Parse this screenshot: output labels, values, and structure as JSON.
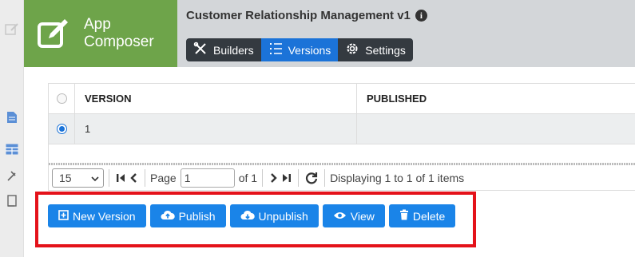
{
  "brand": {
    "line1": "App",
    "line2": "Composer"
  },
  "app": {
    "title": "Customer Relationship Management v1"
  },
  "tabs": [
    {
      "label": "Builders",
      "icon": "tools-icon"
    },
    {
      "label": "Versions",
      "icon": "list-icon"
    },
    {
      "label": "Settings",
      "icon": "gear-icon"
    }
  ],
  "grid": {
    "columns": [
      "VERSION",
      "PUBLISHED"
    ],
    "rows": [
      {
        "version": "1",
        "published": ""
      }
    ]
  },
  "pager": {
    "page_size": "15",
    "page_label": "Page",
    "page_value": "1",
    "of_label": "of 1",
    "display_text": "Displaying 1 to 1 of 1 items"
  },
  "actions": {
    "new_version": "New Version",
    "publish": "Publish",
    "unpublish": "Unpublish",
    "view": "View",
    "delete": "Delete"
  },
  "colors": {
    "brand": "#6ea44a",
    "accent": "#1a84e8",
    "tab_bg": "#343a40",
    "highlight": "#e4121a"
  }
}
